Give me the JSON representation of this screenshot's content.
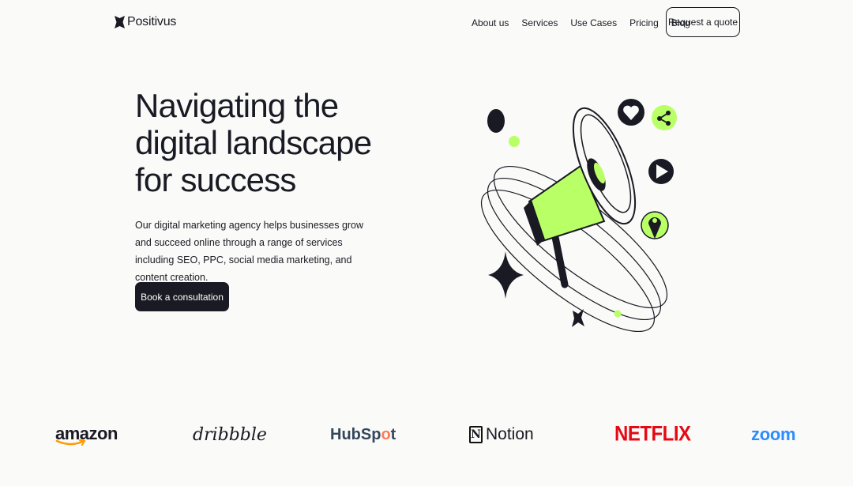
{
  "nav": {
    "logo": "Positivus",
    "items": [
      "About us",
      "Services",
      "Use Cases",
      "Pricing",
      "Blog"
    ],
    "cta": "Request a quote"
  },
  "hero": {
    "title": "Navigating the digital landscape for success",
    "description": "Our digital marketing agency helps businesses grow and succeed online through a range of services including SEO, PPC, social media marketing, and content creation.",
    "cta": "Book a consultation"
  },
  "brands": {
    "amazon": "amazon",
    "dribbble": "dribbble",
    "hubspot_a": "HubSp",
    "hubspot_o": "o",
    "hubspot_b": "t",
    "notion_box": "N",
    "notion": "Notion",
    "netflix": "NETFLIX",
    "zoom": "zoom"
  },
  "colors": {
    "accent": "#b9ff66",
    "dark": "#191a23",
    "background": "#fafaf8"
  },
  "icons": [
    "logo-mark-icon",
    "megaphone-illustration",
    "heart-icon",
    "share-icon",
    "play-icon",
    "location-pin-icon",
    "sparkle-icon"
  ]
}
